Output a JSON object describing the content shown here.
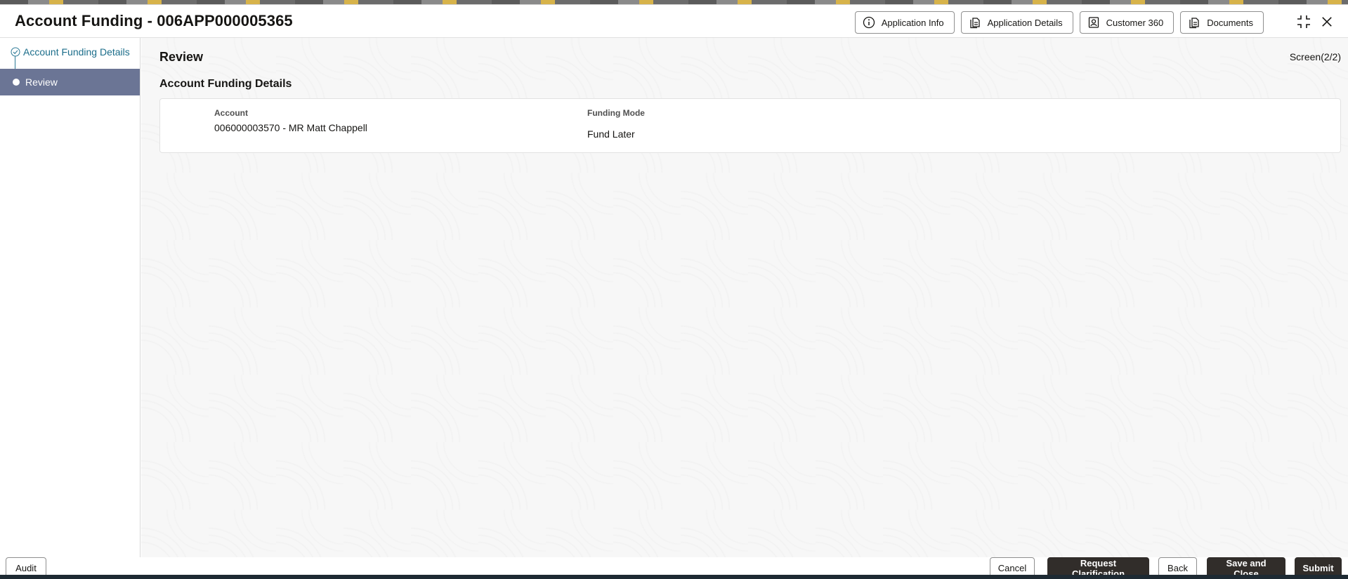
{
  "header": {
    "title": "Account Funding - 006APP000005365",
    "actions": [
      {
        "label": "Application Info",
        "icon": "info-icon"
      },
      {
        "label": "Application Details",
        "icon": "document-icon"
      },
      {
        "label": "Customer 360",
        "icon": "person-card-icon"
      },
      {
        "label": "Documents",
        "icon": "document-icon"
      }
    ]
  },
  "nav": {
    "items": [
      {
        "label": "Account Funding Details",
        "state": "completed"
      },
      {
        "label": "Review",
        "state": "active"
      }
    ]
  },
  "main": {
    "section_title": "Review",
    "screen_indicator": "Screen(2/2)",
    "subsection_title": "Account Funding Details",
    "fields": [
      {
        "label": "Account",
        "value": "006000003570 - MR Matt Chappell"
      },
      {
        "label": "Funding Mode",
        "value": "Fund Later"
      }
    ]
  },
  "footer": {
    "audit": "Audit",
    "cancel": "Cancel",
    "request_clarification": "Request Clarification",
    "back": "Back",
    "save_and_close": "Save and Close",
    "submit": "Submit"
  },
  "colors": {
    "accent": "#1b6d8a",
    "nav_active_bg": "#6b7595",
    "primary_button": "#312d2a"
  }
}
